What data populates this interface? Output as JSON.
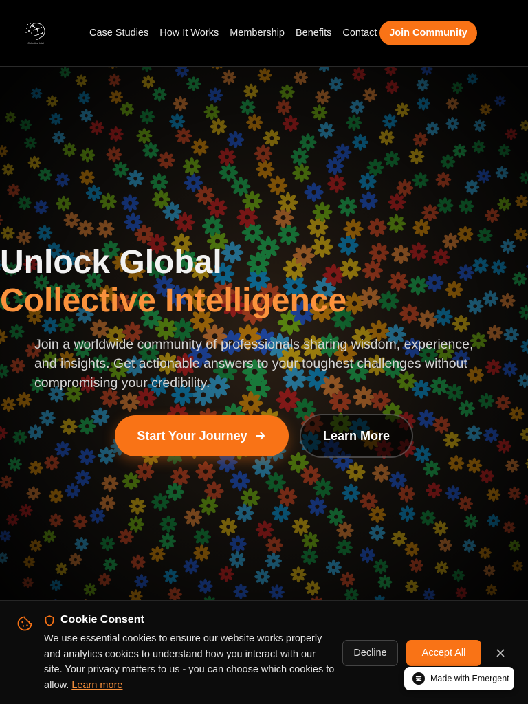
{
  "header": {
    "logo_icon": "network-brain-logo",
    "logo_caption": "Collective Intel",
    "nav": [
      {
        "label": "Case Studies"
      },
      {
        "label": "How It Works"
      },
      {
        "label": "Membership"
      },
      {
        "label": "Benefits"
      },
      {
        "label": "Contact"
      }
    ],
    "cta_label": "Join Community"
  },
  "hero": {
    "title_line_1": "Unlock Global",
    "title_line_2": "Collective Intelligence",
    "subtitle": "Join a worldwide community of professionals sharing wisdom, experience, and insights. Get actionable answers to your toughest challenges without compromising your credibility.",
    "primary_button": "Start Your Journey",
    "secondary_button": "Learn More",
    "accent_color": "#f97316"
  },
  "cookie": {
    "title": "Cookie Consent",
    "text": "We use essential cookies to ensure our website works properly and analytics cookies to understand how you interact with our site. Your privacy matters to us - you can choose which cookies to allow.",
    "learn_more": "Learn more",
    "decline_label": "Decline",
    "accept_label": "Accept All"
  },
  "badge": {
    "label": "Made with Emergent"
  }
}
